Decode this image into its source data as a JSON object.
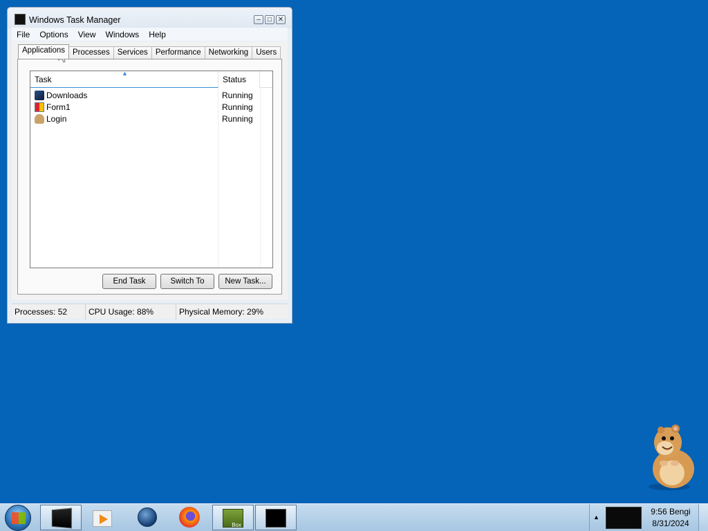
{
  "window": {
    "title": "Windows Task Manager",
    "caption_buttons": {
      "minimize": "–",
      "maximize": "□",
      "close": "✕"
    },
    "menu": [
      "File",
      "Options",
      "View",
      "Windows",
      "Help"
    ],
    "tabs": [
      "Applications",
      "Processes",
      "Services",
      "Performance",
      "Networking",
      "Users"
    ],
    "active_tab": "Applications",
    "columns": {
      "task": "Task",
      "status": "Status",
      "sort_indicator": "▲"
    },
    "tasks": [
      {
        "name": "Downloads",
        "status": "Running",
        "icon": "downloads-icon"
      },
      {
        "name": "Form1",
        "status": "Running",
        "icon": "form-icon"
      },
      {
        "name": "Login",
        "status": "Running",
        "icon": "login-icon"
      }
    ],
    "buttons": {
      "end_task": "End Task",
      "switch_to": "Switch To",
      "new_task": "New Task..."
    },
    "statusbar": {
      "processes": "Processes: 52",
      "cpu": "CPU Usage: 88%",
      "memory": "Physical Memory: 29%"
    }
  },
  "taskbar": {
    "items": [
      "terminal-icon",
      "media-player-icon",
      "earth-icon",
      "firefox-icon",
      "box-game-icon",
      "task-manager-icon"
    ],
    "box_label": "Box",
    "tray": {
      "time": "9:56 Bengi",
      "date": "8/31/2024",
      "expand": "▲"
    }
  },
  "colors": {
    "desktop": "#0563b8",
    "taskbar": "#b6d0e8"
  }
}
